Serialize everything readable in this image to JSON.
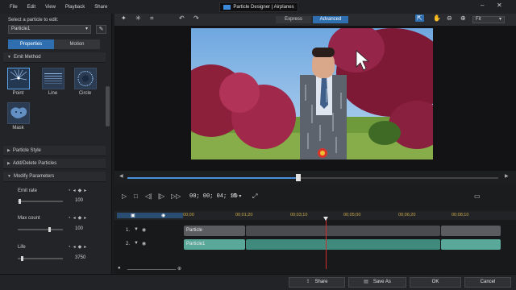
{
  "menu": [
    "File",
    "Edit",
    "View",
    "Playback",
    "Share"
  ],
  "window_title": "Particle Designer | Airplanes",
  "left_panel": {
    "select_label": "Select a particle to edit:",
    "selected_particle": "Particle1",
    "tabs": [
      "Properties",
      "Motion"
    ],
    "sections": {
      "emit_method": "Emit Method",
      "particle_style": "Particle Style",
      "add_delete": "Add/Delete Particles",
      "modify": "Modify Parameters"
    },
    "emit_options": [
      "Point",
      "Line",
      "Circle",
      "Mask"
    ],
    "params": [
      {
        "label": "Emit rate",
        "value": "100",
        "level": 0.02
      },
      {
        "label": "Max count",
        "value": "100",
        "level": 0.72
      },
      {
        "label": "Life",
        "value": "3750",
        "level": 0.08
      }
    ]
  },
  "toolbar": {
    "mode_express": "Express",
    "mode_advanced": "Advanced",
    "fit": "Fit"
  },
  "playback": {
    "timecode": "00; 00; 04; 15",
    "threed": "3D",
    "progress": 0.46
  },
  "timeline": {
    "ticks": [
      "00;00",
      "00;01;20",
      "00;03;10",
      "00;05;00",
      "00;06;20",
      "00;08;10"
    ],
    "tracks": [
      {
        "num": "1.",
        "clip": "Particle"
      },
      {
        "num": "2.",
        "clip": "Particle1"
      }
    ]
  },
  "bottom": {
    "share": "Share",
    "save_as": "Save As",
    "ok": "OK",
    "cancel": "Cancel"
  },
  "colors": {
    "accent": "#2f6fb0",
    "track_selected": "#5aa89a",
    "playhead": "#d12d2d"
  }
}
